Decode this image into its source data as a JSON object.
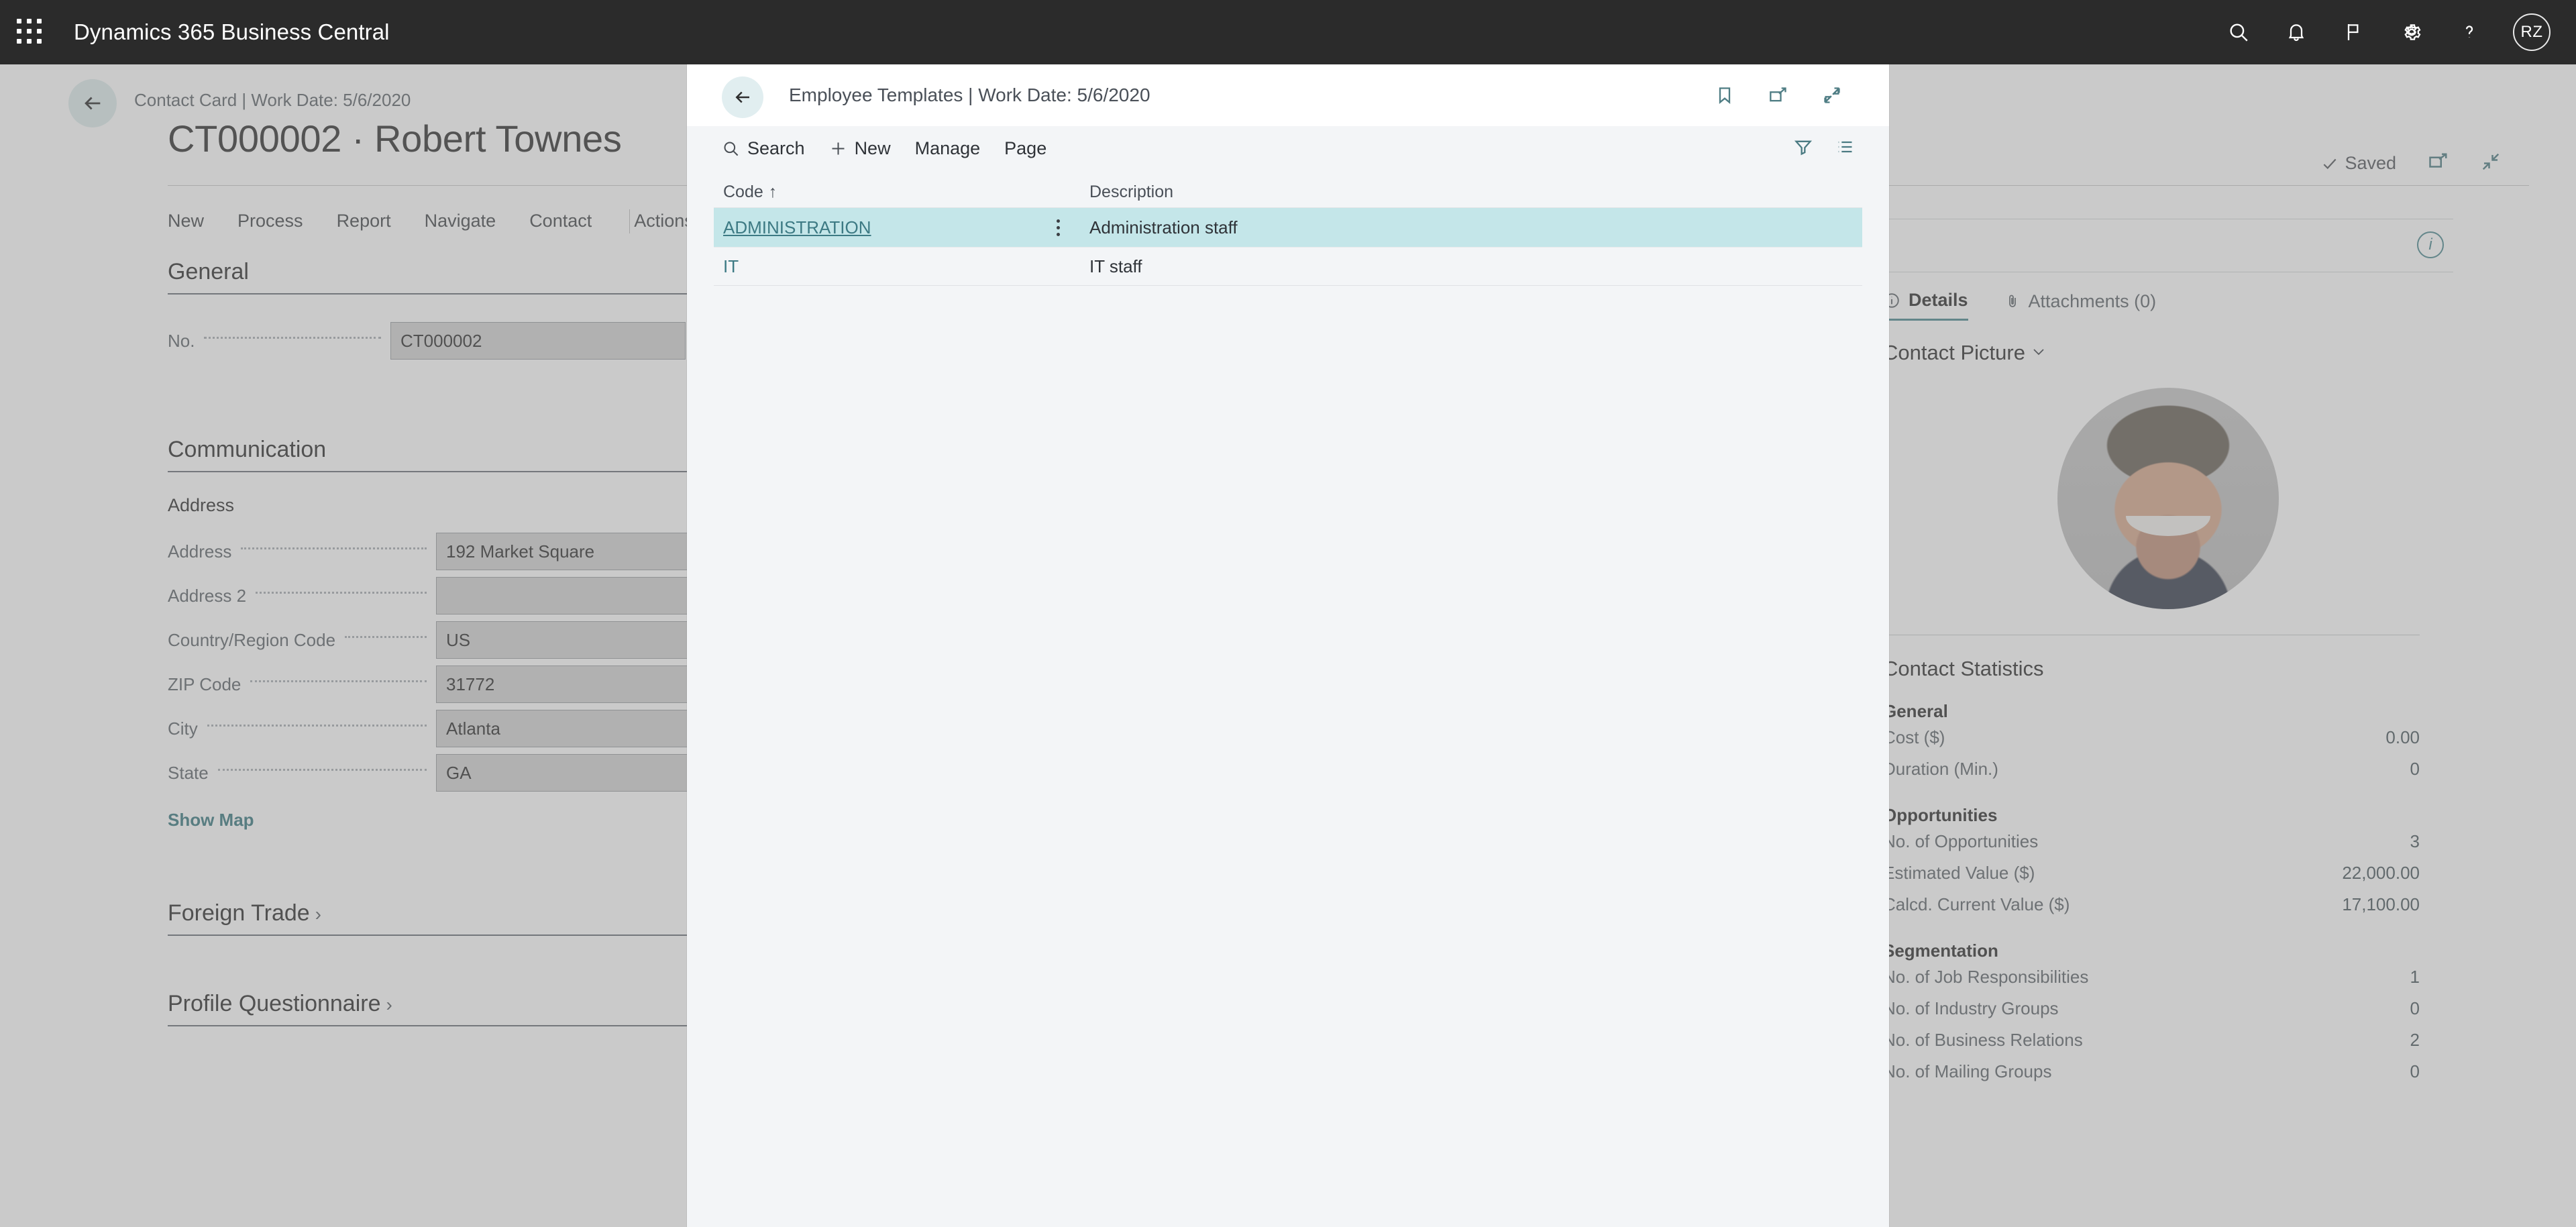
{
  "brandbar": {
    "title": "Dynamics 365 Business Central",
    "icons": [
      "waffle-icon",
      "search-icon",
      "bell-icon",
      "flag-icon",
      "gear-icon",
      "help-icon"
    ],
    "avatar_initials": "RZ"
  },
  "background_page": {
    "breadcrumb": "Contact Card | Work Date: 5/6/2020",
    "title": "CT000002 · Robert Townes",
    "ribbon": [
      "New",
      "Process",
      "Report",
      "Navigate",
      "Contact",
      "Actions"
    ],
    "saved_label": "Saved",
    "sections": {
      "general_title": "General",
      "communication_title": "Communication",
      "address_subhead": "Address",
      "show_map_link": "Show Map",
      "foreign_trade_title": "Foreign Trade",
      "profile_questionnaire_title": "Profile Questionnaire"
    },
    "fields": [
      {
        "label": "No.",
        "value": "CT000002",
        "type": "lookup"
      },
      {
        "label": "Address",
        "value": "192 Market Square",
        "type": "text"
      },
      {
        "label": "Address 2",
        "value": "",
        "type": "text"
      },
      {
        "label": "Country/Region Code",
        "value": "US",
        "type": "dropdown"
      },
      {
        "label": "ZIP Code",
        "value": "31772",
        "type": "assist"
      },
      {
        "label": "City",
        "value": "Atlanta",
        "type": "assist"
      },
      {
        "label": "State",
        "value": "GA",
        "type": "text"
      }
    ],
    "factbox": {
      "tabs": [
        {
          "label": "Details",
          "icon": "info-icon",
          "active": true
        },
        {
          "label": "Attachments (0)",
          "icon": "paperclip-icon",
          "active": false
        }
      ],
      "contact_picture_title": "Contact Picture",
      "statistics_title": "Contact Statistics",
      "groups": [
        {
          "name": "General",
          "rows": [
            {
              "label": "Cost ($)",
              "value": "0.00"
            },
            {
              "label": "Duration (Min.)",
              "value": "0"
            }
          ]
        },
        {
          "name": "Opportunities",
          "rows": [
            {
              "label": "No. of Opportunities",
              "value": "3"
            },
            {
              "label": "Estimated Value ($)",
              "value": "22,000.00"
            },
            {
              "label": "Calcd. Current Value ($)",
              "value": "17,100.00"
            }
          ]
        },
        {
          "name": "Segmentation",
          "rows": [
            {
              "label": "No. of Job Responsibilities",
              "value": "1"
            },
            {
              "label": "No. of Industry Groups",
              "value": "0"
            },
            {
              "label": "No. of Business Relations",
              "value": "2"
            },
            {
              "label": "No. of Mailing Groups",
              "value": "0"
            }
          ]
        }
      ]
    }
  },
  "modal": {
    "title": "Employee Templates | Work Date: 5/6/2020",
    "header_actions": [
      "bookmark-icon",
      "open-in-new-window-icon",
      "expand-icon"
    ],
    "toolbar": [
      {
        "label": "Search",
        "icon": "search-icon"
      },
      {
        "label": "New",
        "icon": "plus-icon"
      },
      {
        "label": "Manage",
        "icon": ""
      },
      {
        "label": "Page",
        "icon": ""
      }
    ],
    "toolbar_right": [
      "filter-icon",
      "list-view-icon"
    ],
    "grid": {
      "columns": [
        "Code",
        "Description"
      ],
      "sort_indicator": "↑",
      "sorted_column": "Code",
      "rows": [
        {
          "code": "ADMINISTRATION",
          "description": "Administration staff",
          "selected": true
        },
        {
          "code": "IT",
          "description": "IT staff",
          "selected": false
        }
      ]
    }
  },
  "colors": {
    "brandbar_bg": "#2b2b2b",
    "accent_teal": "#4f7d84",
    "selected_row": "#c4e6e9",
    "modal_bg": "#f3f5f7",
    "back_circle": "#e1eef0"
  }
}
